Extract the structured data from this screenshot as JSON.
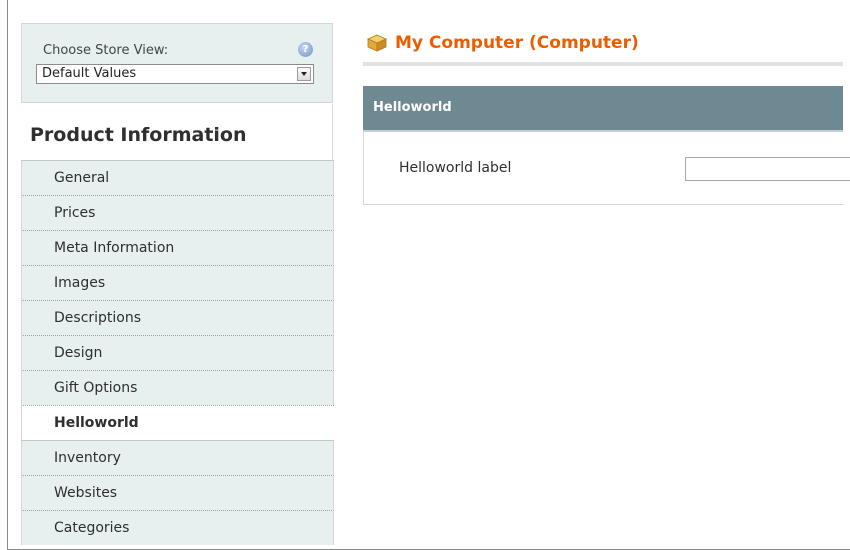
{
  "store_switcher": {
    "label": "Choose Store View:",
    "selected": "Default Values",
    "help": "?"
  },
  "tabs": {
    "title": "Product Information",
    "items": [
      {
        "label": "General",
        "active": false
      },
      {
        "label": "Prices",
        "active": false
      },
      {
        "label": "Meta Information",
        "active": false
      },
      {
        "label": "Images",
        "active": false
      },
      {
        "label": "Descriptions",
        "active": false
      },
      {
        "label": "Design",
        "active": false
      },
      {
        "label": "Gift Options",
        "active": false
      },
      {
        "label": "Helloworld",
        "active": true
      },
      {
        "label": "Inventory",
        "active": false
      },
      {
        "label": "Websites",
        "active": false
      },
      {
        "label": "Categories",
        "active": false
      }
    ]
  },
  "page": {
    "title": "My Computer (Computer)",
    "title_color": "#eb5e00"
  },
  "fieldset": {
    "legend": "Helloworld",
    "header_color": "#6f8992",
    "field_label": "Helloworld label",
    "field_value": ""
  },
  "icons": {
    "title_icon": "product-box-icon",
    "help_icon": "help-icon",
    "select_arrow": "chevron-down-icon"
  }
}
